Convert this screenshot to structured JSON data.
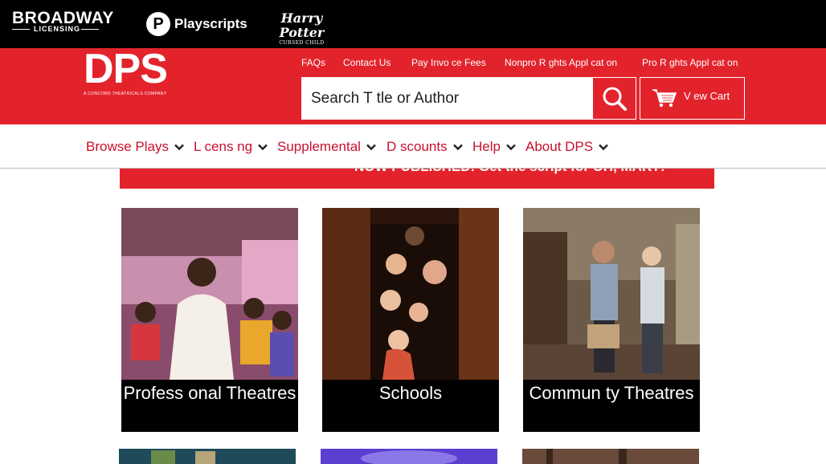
{
  "brands": {
    "broadway": "BROADWAY",
    "broadway_sub": "LICENSING",
    "playscripts_letter": "P",
    "playscripts": "Playscripts",
    "harry_potter": "Harry Potter",
    "harry_potter_sub": "CURSED CHILD"
  },
  "logo": {
    "name": "DPS",
    "tagline": "A CONCORD THEATRICALS COMPANY"
  },
  "top_links": [
    "FAQs",
    "Contact Us",
    "Pay Invo ce Fees",
    "Nonpro R ghts Appl cat on",
    "Pro R ghts Appl cat on"
  ],
  "search": {
    "placeholder": "Search T tle or Author"
  },
  "cart": {
    "label": "V ew Cart"
  },
  "nav": [
    "Browse Plays",
    "L cens ng",
    "Supplemental",
    "D scounts",
    "Help",
    "About DPS"
  ],
  "banner": {
    "text": "NOW PUBLISHED: Get the script for OH, MARY!"
  },
  "tiles": [
    {
      "caption": "Profess onal Theatres"
    },
    {
      "caption": "Schools"
    },
    {
      "caption": "Commun ty Theatres"
    }
  ],
  "colors": {
    "brand_red": "#e3232c",
    "nav_text": "#c8102e",
    "black": "#000000"
  },
  "icons": {
    "search": "search-icon",
    "cart": "cart-icon",
    "chevron": "chevron-down-icon"
  }
}
